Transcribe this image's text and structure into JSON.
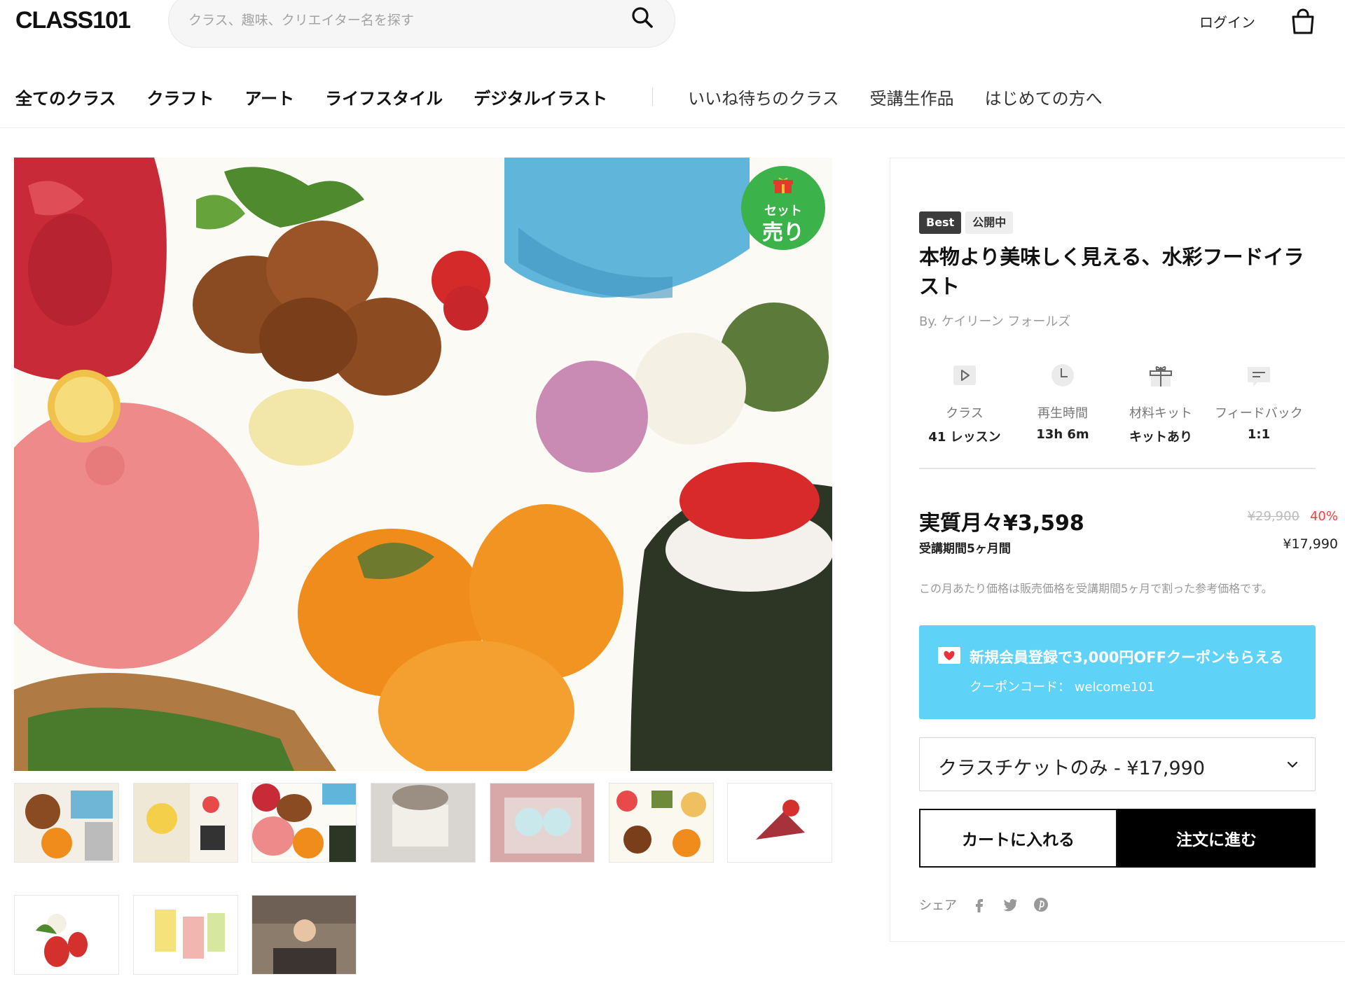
{
  "header": {
    "logo": "CLASS101",
    "search_placeholder": "クラス、趣味、クリエイター名を探す",
    "login_label": "ログイン"
  },
  "nav": {
    "primary": [
      "全てのクラス",
      "クラフト",
      "アート",
      "ライフスタイル",
      "デジタルイラスト"
    ],
    "secondary": [
      "いいね待ちのクラス",
      "受講生作品",
      "はじめての方へ"
    ]
  },
  "hero": {
    "badge_top": "セット",
    "badge_bottom": "売り"
  },
  "product": {
    "badges": [
      "Best",
      "公開中"
    ],
    "title": "本物より美味しく見える、水彩フードイラスト",
    "author": "By. ケイリーン フォールズ",
    "stats": [
      {
        "icon": "play-icon",
        "label": "クラス",
        "value": "41 レッスン"
      },
      {
        "icon": "clock-icon",
        "label": "再生時間",
        "value": "13h 6m"
      },
      {
        "icon": "gift-icon",
        "label": "材料キット",
        "value": "キットあり"
      },
      {
        "icon": "chat-icon",
        "label": "フィードバック",
        "value": "1:1"
      }
    ],
    "price_monthly": "実質月々¥3,598",
    "period": "受講期間5ヶ月間",
    "original_price": "¥29,900",
    "discount": "40%",
    "sale_price": "¥17,990",
    "note": "この月あたり価格は販売価格を受講期間5ヶ月で割った参考価格です。",
    "coupon_title": "新規会員登録で3,000円OFFクーポンもらえる",
    "coupon_code": "クーポンコード： welcome101",
    "option_selected": "クラスチケットのみ - ¥17,990",
    "add_to_cart": "カートに入れる",
    "order": "注文に進む",
    "share_label": "シェア"
  },
  "colors": {
    "accent_coupon": "#5fd2f8",
    "discount_red": "#ff3b3b",
    "badge_green": "#3bb24a"
  }
}
